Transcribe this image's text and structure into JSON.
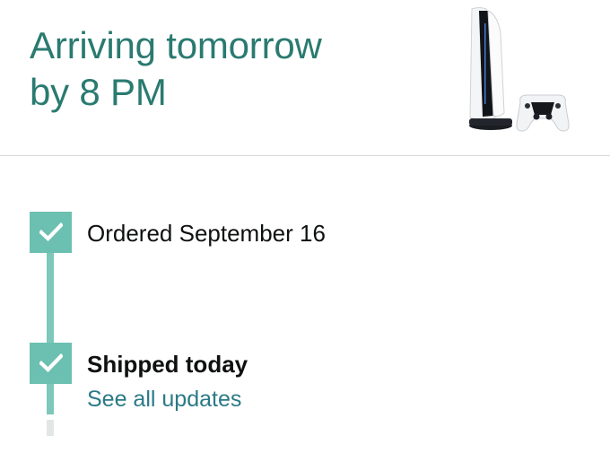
{
  "header": {
    "headline_line1": "Arriving tomorrow",
    "headline_line2": "by 8 PM"
  },
  "product": {
    "image": "game-console-with-controller"
  },
  "tracker": {
    "steps": [
      {
        "label": "Ordered September 16",
        "status": "complete"
      },
      {
        "label": "Shipped today",
        "status": "complete"
      }
    ],
    "updates_link": "See all updates"
  },
  "colors": {
    "headline": "#2a7a70",
    "progress_fill": "#6cc0b1",
    "progress_line": "#7dc8bb",
    "link": "#2a7a86",
    "text": "#0f1111",
    "divider": "#d5d9d9"
  }
}
